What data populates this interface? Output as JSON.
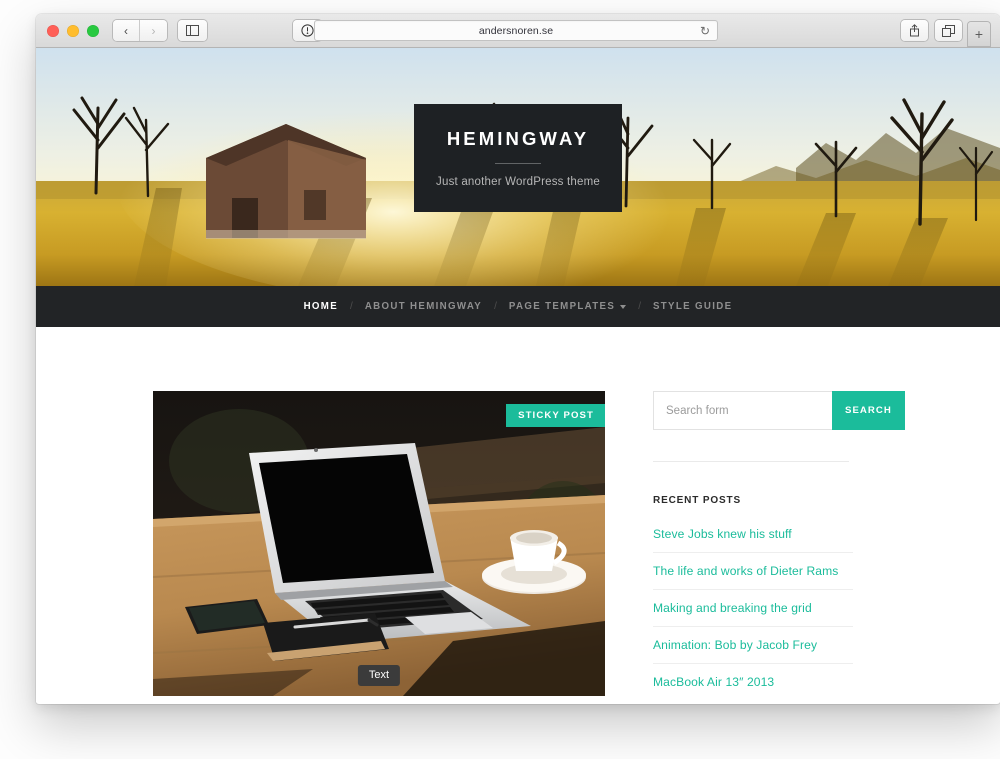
{
  "browser": {
    "url": "andersnoren.se",
    "back_label": "‹",
    "forward_label": "›",
    "sidebar_icon": "sidebar-icon",
    "shield_icon": "reader-icon",
    "reload_label": "↻",
    "share_icon": "share-icon",
    "tabs_icon": "tabs-icon",
    "newtab_label": "+"
  },
  "hero": {
    "site_title": "HEMINGWAY",
    "tagline": "Just another WordPress theme",
    "image_alt": "sunset-field-barn-photo"
  },
  "nav": {
    "separator": "/",
    "items": [
      {
        "label": "HOME",
        "active": true,
        "has_caret": false
      },
      {
        "label": "ABOUT HEMINGWAY",
        "active": false,
        "has_caret": false
      },
      {
        "label": "PAGE TEMPLATES",
        "active": false,
        "has_caret": true
      },
      {
        "label": "STYLE GUIDE",
        "active": false,
        "has_caret": false
      }
    ]
  },
  "post": {
    "sticky_badge": "STICKY POST",
    "format_badge": "Text",
    "image_alt": "laptop-on-wooden-desk-photo"
  },
  "sidebar": {
    "search": {
      "placeholder": "Search form",
      "button_label": "SEARCH"
    },
    "recent_posts": {
      "title": "RECENT POSTS",
      "items": [
        {
          "label": "Steve Jobs knew his stuff"
        },
        {
          "label": "The life and works of Dieter Rams"
        },
        {
          "label": "Making and breaking the grid"
        },
        {
          "label": "Animation: Bob by Jacob Frey"
        },
        {
          "label": "MacBook Air 13″ 2013"
        }
      ]
    }
  },
  "colors": {
    "accent": "#1bbc9b",
    "nav_bg": "#222426",
    "title_box_bg": "#1e2124",
    "badge_dark": "#3b3b3b"
  }
}
